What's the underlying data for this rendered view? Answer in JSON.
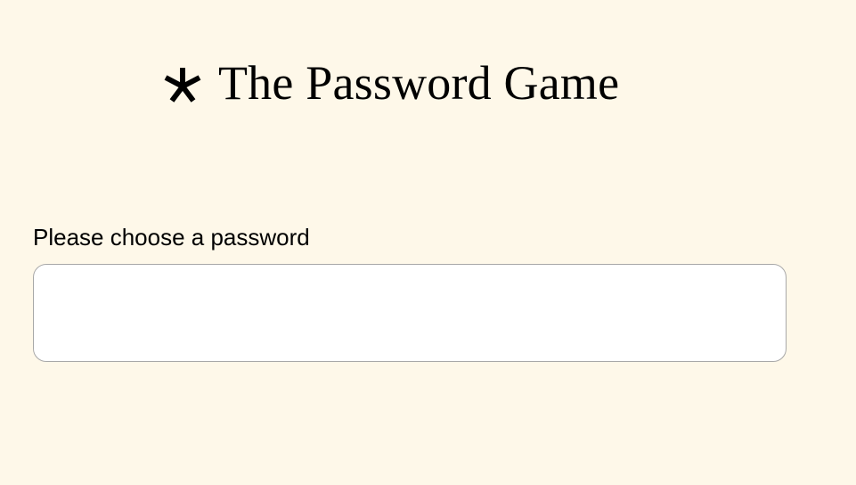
{
  "header": {
    "logo_icon": "asterisk-icon",
    "title": "The Password Game"
  },
  "form": {
    "label": "Please choose a password",
    "password_value": "",
    "placeholder": ""
  },
  "colors": {
    "background": "#fef8e9",
    "input_background": "#ffffff",
    "input_border": "#a8a8a8",
    "text": "#000000"
  }
}
